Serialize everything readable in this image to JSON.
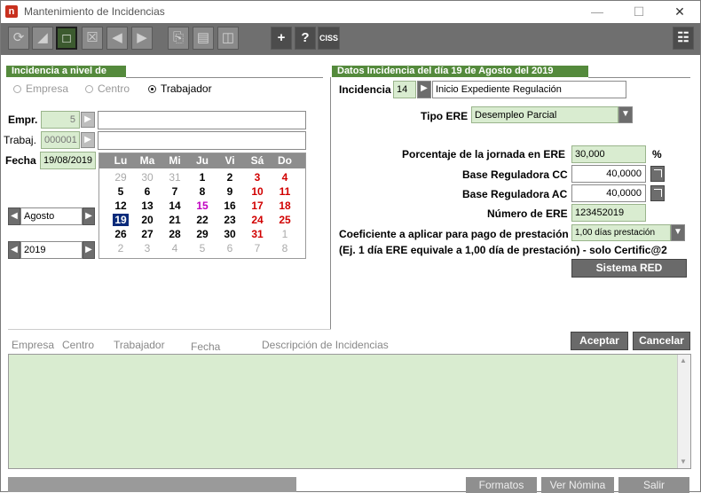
{
  "window": {
    "title": "Mantenimiento de Incidencias"
  },
  "toolbar": {
    "plus_label": "+",
    "help_label": "?",
    "ciss_label": "CISS"
  },
  "left": {
    "section_title": "Incidencia a nivel de",
    "radios": [
      "Empresa",
      "Centro",
      "Trabajador"
    ],
    "empr_label": "Empr.",
    "empr_value": "5",
    "trabaj_label": "Trabaj.",
    "trabaj_value": "000001",
    "fecha_label": "Fecha",
    "fecha_value": "19/08/2019",
    "month_value": "Agosto",
    "year_value": "2019"
  },
  "calendar": {
    "days_header": [
      "Lu",
      "Ma",
      "Mi",
      "Ju",
      "Vi",
      "Sá",
      "Do"
    ],
    "weeks": [
      [
        "29",
        "30",
        "31",
        "1",
        "2",
        "3",
        "4"
      ],
      [
        "5",
        "6",
        "7",
        "8",
        "9",
        "10",
        "11"
      ],
      [
        "12",
        "13",
        "14",
        "15",
        "16",
        "17",
        "18"
      ],
      [
        "19",
        "20",
        "21",
        "22",
        "23",
        "24",
        "25"
      ],
      [
        "26",
        "27",
        "28",
        "29",
        "30",
        "31",
        "1"
      ],
      [
        "2",
        "3",
        "4",
        "5",
        "6",
        "7",
        "8"
      ]
    ],
    "selected_day": "19"
  },
  "right": {
    "section_title": "Datos Incidencia del día 19 de Agosto del 2019",
    "incidencia_label": "Incidencia",
    "incidencia_code": "14",
    "incidencia_desc": "Inicio Expediente Regulación",
    "tipo_ere_label": "Tipo ERE",
    "tipo_ere_value": "Desempleo Parcial",
    "porcentaje_label": "Porcentaje de la jornada en ERE",
    "porcentaje_value": "30,000",
    "porcentaje_unit": "%",
    "base_cc_label": "Base Reguladora CC",
    "base_cc_value": "40,0000",
    "base_ac_label": "Base Reguladora AC",
    "base_ac_value": "40,0000",
    "numero_ere_label": "Número de ERE",
    "numero_ere_value": "123452019",
    "coef_label": "Coeficiente a aplicar para pago de prestación",
    "coef_value": "1,00 días prestación",
    "note": "(Ej. 1 día ERE equivale a 1,00 día de prestación) - solo Certific@2",
    "sistema_red_label": "Sistema RED"
  },
  "actions": {
    "accept": "Aceptar",
    "cancel": "Cancelar"
  },
  "list": {
    "columns": [
      "Empresa",
      "Centro",
      "Trabajador",
      "Fecha",
      "Descripción de Incidencias"
    ]
  },
  "footer": {
    "formatos": "Formatos",
    "ver_nomina": "Ver Nómina",
    "salir": "Salir"
  },
  "colors": {
    "section_green": "#548a3c",
    "field_green": "#d9ecd0",
    "toolbar_grey": "#6f6f6f",
    "weekend_red": "#d10000",
    "holiday_magenta": "#c000c0"
  }
}
